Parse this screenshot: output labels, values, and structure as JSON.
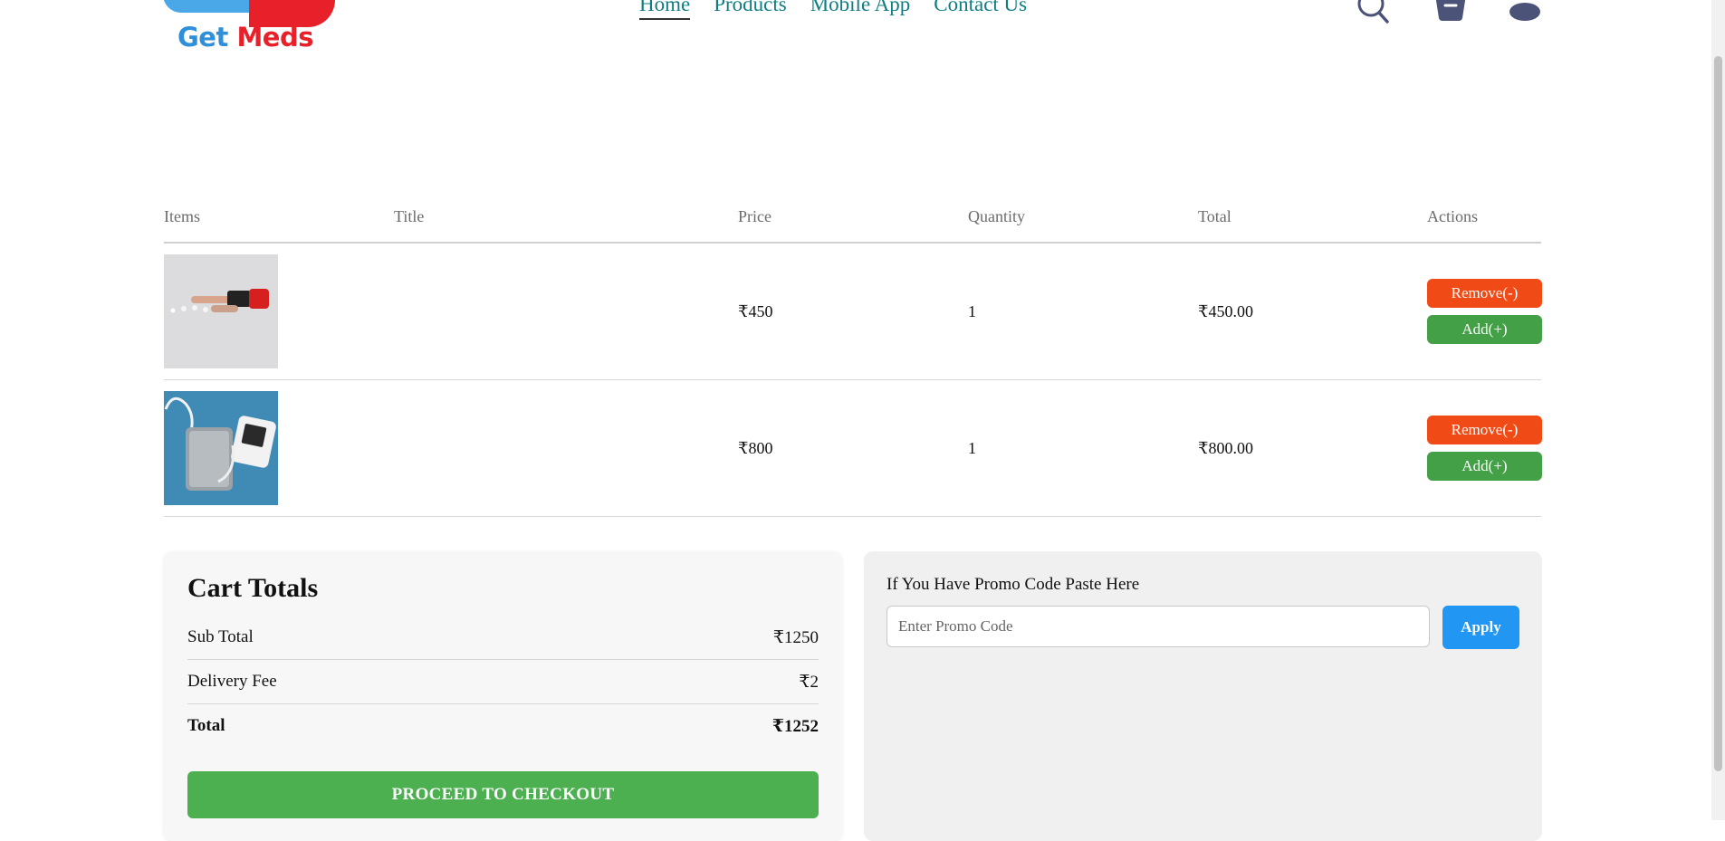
{
  "brand": {
    "get": "Get",
    "meds": "Meds",
    "blue": "#2f8fd9",
    "red": "#e8202a"
  },
  "nav": {
    "items": [
      {
        "label": "Home",
        "active": true
      },
      {
        "label": "Products"
      },
      {
        "label": "Mobile App"
      },
      {
        "label": "Contact Us"
      }
    ],
    "color": "#0f7d82"
  },
  "header_icons": [
    "search-icon",
    "shopping-bag-icon",
    "profile-icon"
  ],
  "table": {
    "headers": {
      "items": "Items",
      "title": "Title",
      "price": "Price",
      "quantity": "Quantity",
      "total": "Total",
      "actions": "Actions"
    },
    "rows": [
      {
        "image": "pills-hand-image",
        "title": "",
        "price": "₹450",
        "quantity": "1",
        "total": "₹450.00"
      },
      {
        "image": "bp-monitor-image",
        "title": "",
        "price": "₹800",
        "quantity": "1",
        "total": "₹800.00"
      }
    ],
    "remove_label": "Remove(-)",
    "add_label": "Add(+)"
  },
  "totals": {
    "heading": "Cart Totals",
    "subtotal_label": "Sub Total",
    "subtotal_value": "₹1250",
    "delivery_label": "Delivery Fee",
    "delivery_value": "₹2",
    "total_label": "Total",
    "total_value": "₹1252",
    "checkout_label": "PROCEED TO CHECKOUT"
  },
  "promo": {
    "label": "If You Have Promo Code Paste Here",
    "placeholder": "Enter Promo Code",
    "value": "",
    "apply_label": "Apply"
  },
  "colors": {
    "remove": "#f04a16",
    "add": "#43a047",
    "checkout": "#4caf50",
    "apply": "#2196f3"
  }
}
